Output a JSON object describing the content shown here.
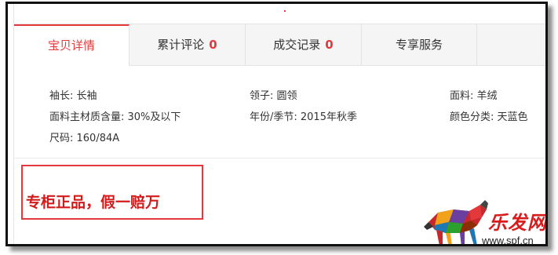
{
  "tabs": [
    {
      "label": "宝贝详情",
      "count": null,
      "active": true
    },
    {
      "label": "累计评论",
      "count": "0",
      "active": false
    },
    {
      "label": "成交记录",
      "count": "0",
      "active": false
    },
    {
      "label": "专享服务",
      "count": null,
      "active": false
    }
  ],
  "attributes": [
    "袖长: 长袖",
    "领子: 圆领",
    "面料: 羊绒",
    "面料主材质含量: 30%及以下",
    "年份/季节: 2015年秋季",
    "颜色分类: 天蓝色",
    "尺码: 160/84A"
  ],
  "promo": {
    "text": "专柜正品，假一赔万"
  },
  "watermark": {
    "logo_text": "乐发网",
    "url": "www.spf.cn"
  },
  "colors": {
    "accent": "#e4393c",
    "promo_red": "#d41b1b",
    "tab_bg": "#f5f5f5"
  }
}
